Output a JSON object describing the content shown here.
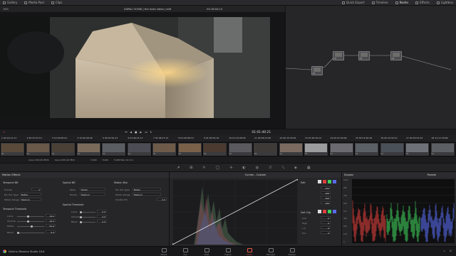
{
  "topbar": {
    "items": [
      "Gallery",
      "Media Pool",
      "Clips"
    ],
    "right_items": [
      "Quick Export",
      "Timeline",
      "Nodes",
      "Effects",
      "Lightbox"
    ]
  },
  "viewer": {
    "zoom": "16%",
    "title": "ZAPALI VOGNI | the main video | edit",
    "timecode": "00:16:04:14",
    "mode": "Clip"
  },
  "transport": {
    "timecode": "01:01:40:21"
  },
  "clip_timecodes": [
    "02:14:11:17",
    "00:47:27:13",
    "12:40:25:01",
    "12:40:28:00",
    "00:47:44:13",
    "01:00:21:17",
    "01:06:17:13",
    "01:00:06:13",
    "01:02:34:19",
    "01:23:38:03",
    "00:03:21:06",
    "00:15:29:01",
    "01:00:19:13",
    "00:21:09:09",
    "00:11:46:18",
    "00:10:32:13",
    "00:15:54:24",
    "11:17:18:09"
  ],
  "clip_names": [
    "V1",
    "V1",
    "V1",
    "V1",
    "V1",
    "V1",
    "V1",
    "V1",
    "V1",
    "V1",
    "V1",
    "V1",
    "V1",
    "V1",
    "V1",
    "V1",
    "V1",
    "V1"
  ],
  "clip_codecs": [
    "Canon EOS 4K HEVC",
    "Canon EOS 4K HEVC",
    "H.264",
    "H.264",
    "H.265 Main 10 L5.1"
  ],
  "motion_effects": {
    "title": "Motion Effects",
    "temporal_nr": {
      "label": "Temporal NR",
      "frames_label": "Frames",
      "frames_value": "2",
      "mo_est_label": "Mo. Est. Type",
      "mo_est_value": "Better",
      "motion_range_label": "Motion Range",
      "motion_range_value": "Medium"
    },
    "spatial_nr": {
      "label": "Spatial NR",
      "mode_label": "Mode",
      "mode_value": "Faster",
      "radius_label": "Radius",
      "radius_value": "Medium"
    },
    "motion_blur": {
      "label": "Motion Blur",
      "mo_est_label": "Mo. Est. Type",
      "mo_est_value": "Better",
      "motion_range_label": "Motion Range",
      "motion_range_value": "Medium",
      "shutter_label": "Shutter Pct.",
      "shutter_value": "0.0"
    },
    "temporal_threshold": {
      "label": "Temporal Threshold",
      "luma_label": "Luma",
      "luma_value": "16.2",
      "chroma_label": "Chroma",
      "chroma_value": "16.2",
      "motion_label": "Motion",
      "motion_value": "50.0",
      "blend_label": "Blend",
      "blend_value": "0.0"
    },
    "spatial_threshold": {
      "label": "Spatial Threshold",
      "luma_label": "Luma",
      "luma_value": "0.0",
      "chroma_label": "Chroma",
      "chroma_value": "0.0",
      "blend_label": "Blend",
      "blend_value": "0.0"
    }
  },
  "curves": {
    "title": "Curves - Custom",
    "edit_label": "Edit",
    "soft_clip_label": "Soft Clip",
    "edit_values": [
      "100",
      "100",
      "100",
      "100"
    ],
    "soft_fields": [
      "Low",
      "High",
      "L.S.",
      "H.S."
    ],
    "soft_values": [
      "0",
      "0",
      "0",
      "0"
    ]
  },
  "scopes": {
    "title": "Scopes",
    "mode": "Parade",
    "scale": [
      "1023",
      "896",
      "768",
      "640",
      "512",
      "384",
      "256",
      "128",
      "0"
    ],
    "colors": {
      "red": "#e0403c",
      "green": "#3fd05a",
      "blue": "#5a6cf0"
    }
  },
  "bottombar": {
    "app_name": "DaVinci Resolve Studio 18.6",
    "pages": [
      "Media",
      "Cut",
      "Edit",
      "Fusion",
      "Color",
      "Fairlight",
      "Deliver"
    ],
    "active_page": "Color"
  },
  "colors": {
    "accent": "#e8584a",
    "panel": "#262629",
    "background": "#1e1e21"
  }
}
